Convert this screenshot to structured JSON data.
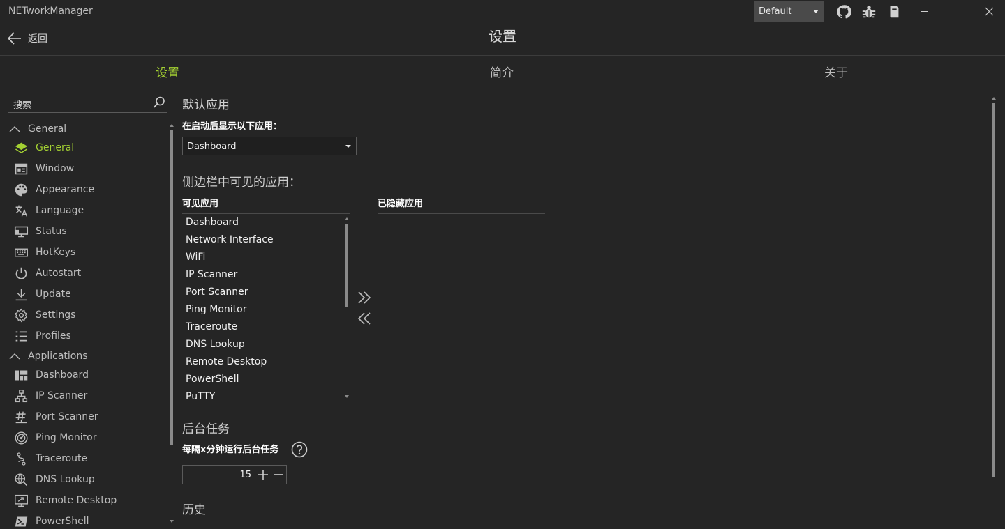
{
  "window": {
    "title": "NETworkManager"
  },
  "titlebar": {
    "theme_value": "Default",
    "icons": [
      "github-icon",
      "bug-icon",
      "book-icon"
    ]
  },
  "header": {
    "back_label": "返回",
    "page_title": "设置"
  },
  "tabs": [
    {
      "label": "设置",
      "active": true
    },
    {
      "label": "简介",
      "active": false
    },
    {
      "label": "关于",
      "active": false
    }
  ],
  "sidebar": {
    "search_placeholder": "搜索",
    "general_group": "General",
    "general_items": [
      {
        "label": "General",
        "icon": "layers-icon",
        "active": true
      },
      {
        "label": "Window",
        "icon": "window-icon"
      },
      {
        "label": "Appearance",
        "icon": "palette-icon"
      },
      {
        "label": "Language",
        "icon": "translate-icon"
      },
      {
        "label": "Status",
        "icon": "monitor-icon"
      },
      {
        "label": "HotKeys",
        "icon": "keyboard-icon"
      },
      {
        "label": "Autostart",
        "icon": "power-icon"
      },
      {
        "label": "Update",
        "icon": "download-icon"
      },
      {
        "label": "Settings",
        "icon": "gear-icon"
      },
      {
        "label": "Profiles",
        "icon": "list-icon"
      }
    ],
    "applications_group": "Applications",
    "application_items": [
      {
        "label": "Dashboard",
        "icon": "dashboard-icon"
      },
      {
        "label": "IP Scanner",
        "icon": "network-icon"
      },
      {
        "label": "Port Scanner",
        "icon": "hash-icon"
      },
      {
        "label": "Ping Monitor",
        "icon": "radar-icon"
      },
      {
        "label": "Traceroute",
        "icon": "route-icon"
      },
      {
        "label": "DNS Lookup",
        "icon": "globe-search-icon"
      },
      {
        "label": "Remote Desktop",
        "icon": "remote-desktop-icon"
      },
      {
        "label": "PowerShell",
        "icon": "powershell-icon"
      }
    ]
  },
  "settings": {
    "default_app": {
      "title": "默认应用",
      "label": "在启动后显示以下应用：",
      "value": "Dashboard"
    },
    "sidebar_apps": {
      "title": "侧边栏中可见的应用：",
      "visible_header": "可见应用",
      "hidden_header": "已隐藏应用",
      "visible_items": [
        "Dashboard",
        "Network Interface",
        "WiFi",
        "IP Scanner",
        "Port Scanner",
        "Ping Monitor",
        "Traceroute",
        "DNS Lookup",
        "Remote Desktop",
        "PowerShell",
        "PuTTY"
      ],
      "hidden_items": []
    },
    "background_job": {
      "title": "后台任务",
      "label": "每隔x分钟运行后台任务",
      "value": "15"
    },
    "history": {
      "title": "历史"
    }
  },
  "colors": {
    "accent": "#a3d032",
    "background": "#252525"
  }
}
